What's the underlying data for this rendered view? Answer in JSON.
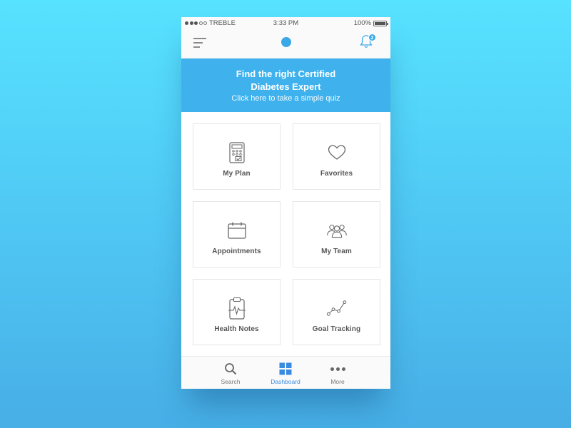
{
  "status_bar": {
    "carrier": "TREBLE",
    "time": "3:33 PM",
    "battery": "100%",
    "signal_bars_filled": 3,
    "signal_bars_total": 5
  },
  "nav": {
    "menu_icon": "hamburger-menu-icon",
    "logo_icon": "logo-dot",
    "notification_icon": "bell-icon",
    "notification_count": "2"
  },
  "banner": {
    "title": "Find the right Certified Diabetes Expert",
    "subtitle": "Click here to take a simple quiz"
  },
  "tiles": [
    {
      "label": "My Plan",
      "icon": "calculator-plan-icon"
    },
    {
      "label": "Favorites",
      "icon": "heart-icon"
    },
    {
      "label": "Appointments",
      "icon": "calendar-icon"
    },
    {
      "label": "My Team",
      "icon": "team-icon"
    },
    {
      "label": "Health Notes",
      "icon": "clipboard-heartbeat-icon"
    },
    {
      "label": "Goal Tracking",
      "icon": "line-chart-icon"
    }
  ],
  "tabs": [
    {
      "label": "Search",
      "icon": "search-icon",
      "active": false
    },
    {
      "label": "Dashboard",
      "icon": "grid-icon",
      "active": true
    },
    {
      "label": "More",
      "icon": "more-dots-icon",
      "active": false
    }
  ],
  "colors": {
    "accent": "#3fb2ee",
    "active_tab": "#3a8be0",
    "background_top": "#57e2ff",
    "background_bottom": "#47aee6"
  }
}
